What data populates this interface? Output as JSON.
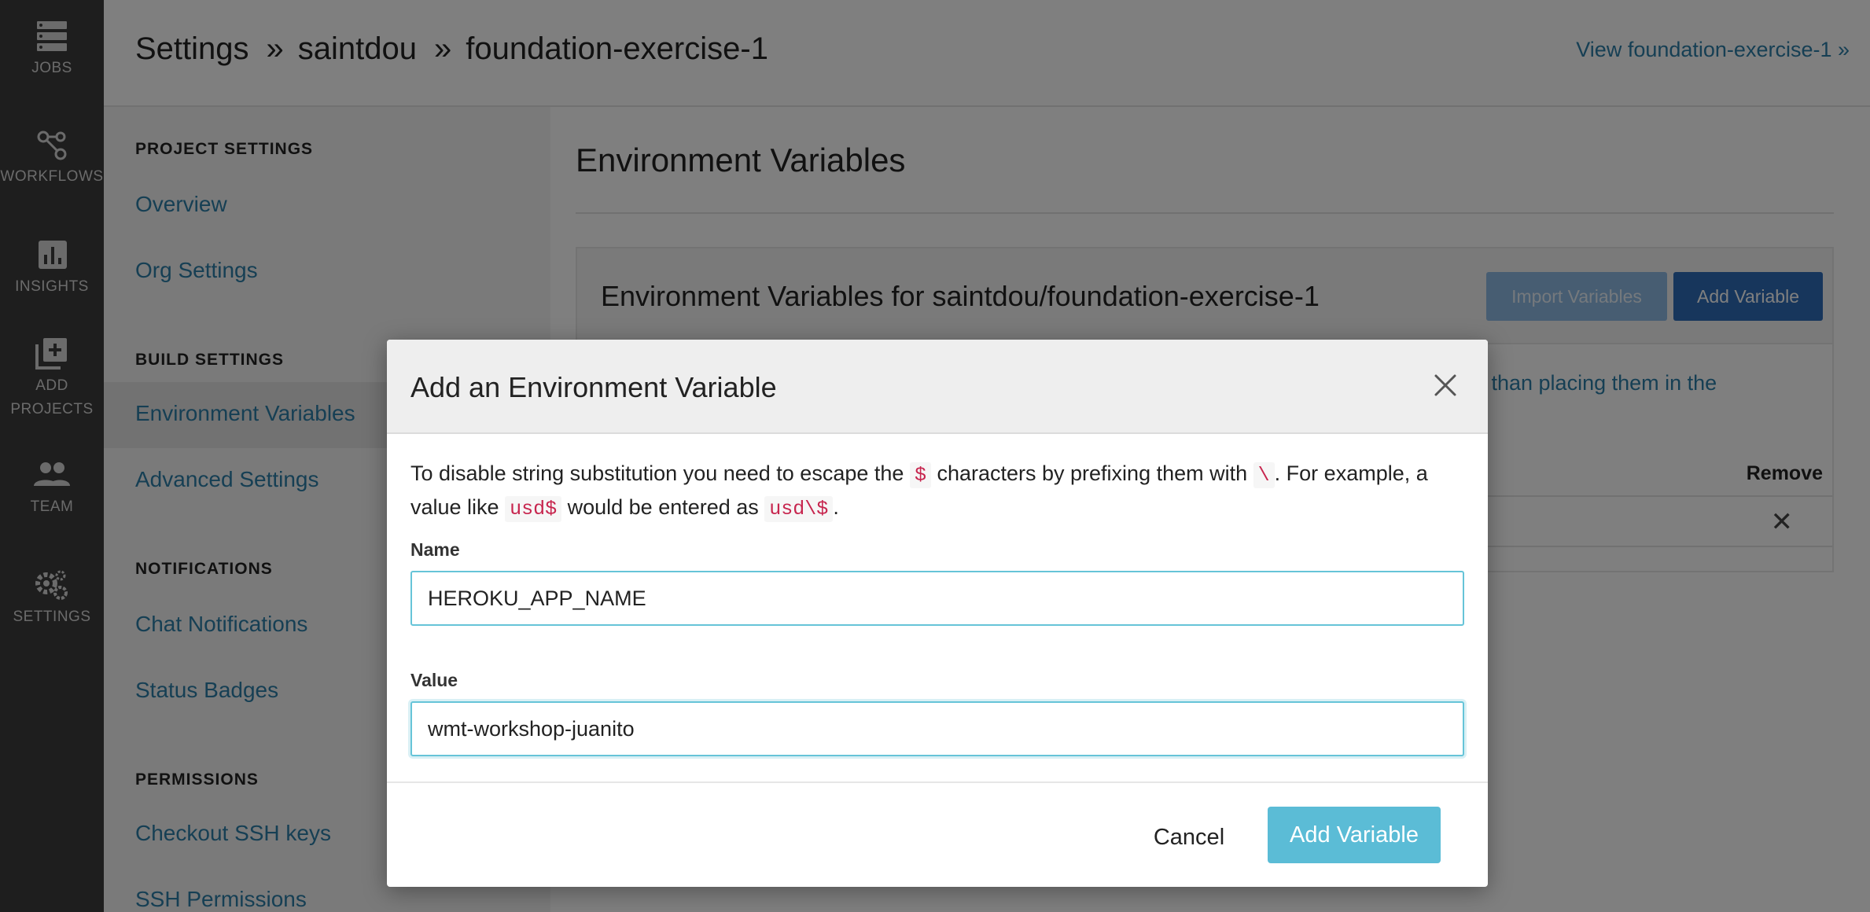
{
  "nav": {
    "items": [
      {
        "label": "JOBS",
        "icon": "jobs-icon"
      },
      {
        "label": "WORKFLOWS",
        "icon": "workflows-icon"
      },
      {
        "label": "INSIGHTS",
        "icon": "insights-icon"
      },
      {
        "label": "ADD PROJECTS",
        "icon": "add-projects-icon"
      },
      {
        "label": "TEAM",
        "icon": "team-icon"
      },
      {
        "label": "SETTINGS",
        "icon": "settings-icon"
      }
    ]
  },
  "header": {
    "crumb1": "Settings",
    "sep1": "»",
    "crumb2": "saintdou",
    "sep2": "»",
    "crumb3": "foundation-exercise-1",
    "view_link": "View foundation-exercise-1 »"
  },
  "sidebar": {
    "project_settings": "PROJECT SETTINGS",
    "overview": "Overview",
    "org_settings": "Org Settings",
    "build_settings": "BUILD SETTINGS",
    "environment_variables": "Environment Variables",
    "advanced_settings": "Advanced Settings",
    "notifications": "NOTIFICATIONS",
    "chat_notifications": "Chat Notifications",
    "status_badges": "Status Badges",
    "permissions": "PERMISSIONS",
    "checkout_ssh_keys": "Checkout SSH keys",
    "ssh_permissions": "SSH Permissions"
  },
  "main": {
    "title": "Environment Variables",
    "card_title": "Environment Variables for saintdou/foundation-exercise-1",
    "import_button": "Import Variables",
    "add_button": "Add Variable",
    "partial_text": "r than placing them in the",
    "remove_header": "Remove"
  },
  "modal": {
    "title": "Add an Environment Variable",
    "desc_1": "To disable string substitution you need to escape the",
    "code_dollar": "$",
    "desc_2": "characters by prefixing them with",
    "code_backslash": "\\",
    "desc_3": ". For example, a value like",
    "code_usd": "usd$",
    "desc_4": "would be entered as",
    "code_usd_escaped": "usd\\$",
    "desc_5": ".",
    "name_label": "Name",
    "name_value": "HEROKU_APP_NAME",
    "value_label": "Value",
    "value_value": "wmt-workshop-juanito",
    "cancel": "Cancel",
    "submit": "Add Variable"
  },
  "colors": {
    "nav_bg": "#3d3d3d",
    "link": "#2c7fa8",
    "primary_button": "#2e6db8",
    "modal_submit": "#5bbcd6",
    "input_border": "#66c4d8",
    "code_text": "#c7254e"
  }
}
